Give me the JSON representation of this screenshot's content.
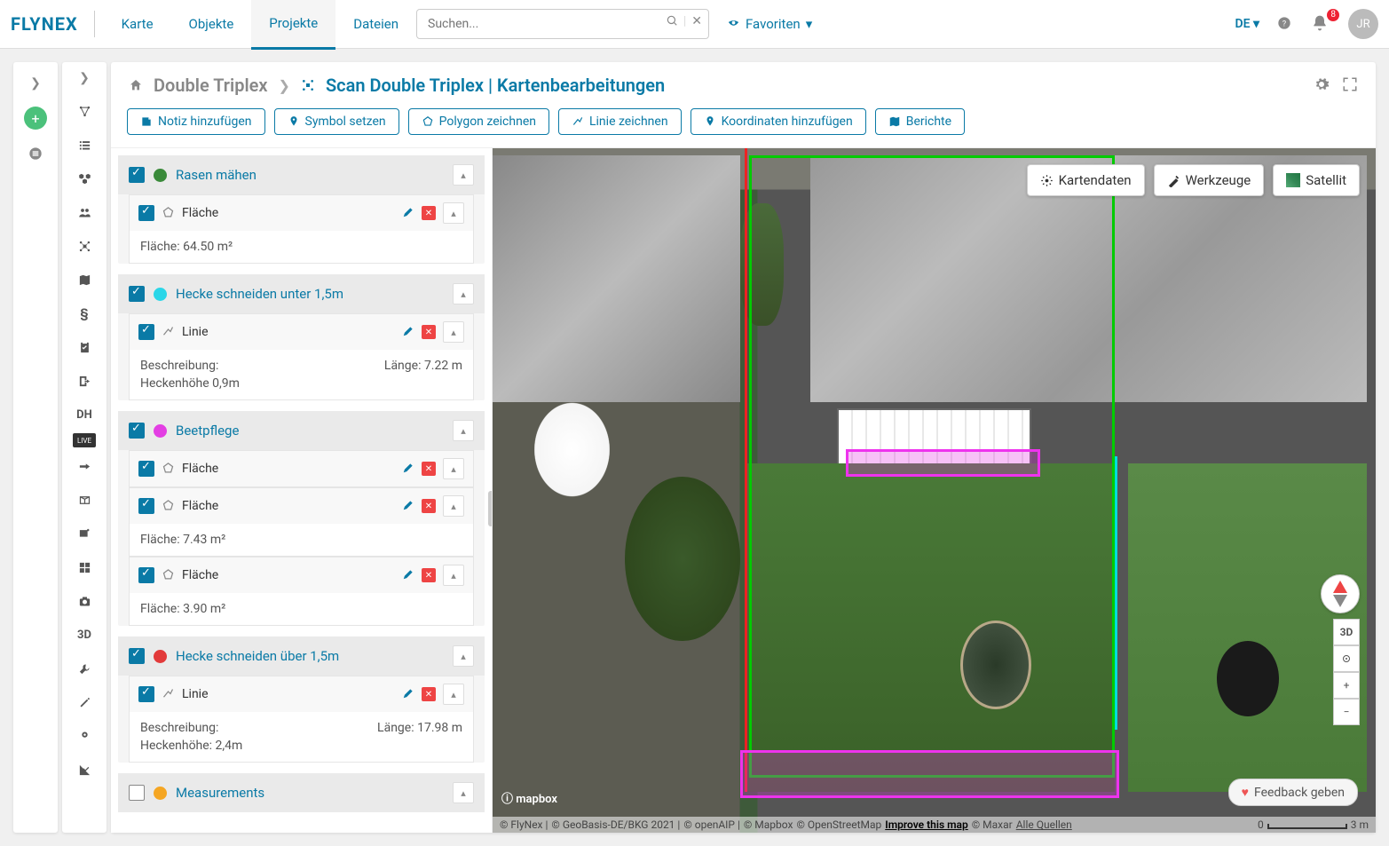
{
  "header": {
    "logo": "FLYNEX",
    "tabs": [
      "Karte",
      "Objekte",
      "Projekte",
      "Dateien"
    ],
    "active_tab": 2,
    "search_placeholder": "Suchen...",
    "favorites_label": "Favoriten",
    "lang": "DE",
    "notif_count": "8",
    "avatar": "JR"
  },
  "breadcrumb": {
    "object": "Double Triplex",
    "title": "Scan Double Triplex | Kartenbearbeitungen"
  },
  "toolbar": {
    "add_note": "Notiz hinzufügen",
    "set_symbol": "Symbol setzen",
    "draw_polygon": "Polygon zeichnen",
    "draw_line": "Linie zeichnen",
    "add_coords": "Koordinaten hinzufügen",
    "reports": "Berichte"
  },
  "map_btns": {
    "data": "Kartendaten",
    "tools": "Werkzeuge",
    "satellite": "Satellit",
    "three_d": "3D",
    "feedback": "Feedback geben",
    "scale_0": "0",
    "scale_3m": "3 m"
  },
  "attrib": {
    "a": "© FlyNex |",
    "b": "© GeoBasis-DE/BKG 2021 |",
    "c": "© openAIP |",
    "d": "© Mapbox",
    "e": "© OpenStreetMap",
    "f": "Improve this map",
    "g": "© Maxar",
    "h": "Alle Quellen"
  },
  "mapbox_logo": "ⓘ mapbox",
  "sidebar2_labels": {
    "dh": "DH",
    "live": "LIVE",
    "threeD": "3D"
  },
  "groups": [
    {
      "name": "Rasen mähen",
      "color": "#3a8a3a",
      "checked": true,
      "items": [
        {
          "shape": "poly",
          "label": "Fläche",
          "body_left": [
            "Fläche: 64.50 m²"
          ],
          "body_right": ""
        }
      ]
    },
    {
      "name": "Hecke schneiden unter 1,5m",
      "color": "#2ad6e8",
      "checked": true,
      "items": [
        {
          "shape": "line",
          "label": "Linie",
          "body_left": [
            "Beschreibung:",
            "Heckenhöhe 0,9m"
          ],
          "body_right": "Länge: 7.22 m"
        }
      ]
    },
    {
      "name": "Beetpflege",
      "color": "#e33ee3",
      "checked": true,
      "items": [
        {
          "shape": "poly",
          "label": "Fläche"
        },
        {
          "shape": "poly",
          "label": "Fläche",
          "body_left": [
            "Fläche: 7.43 m²"
          ],
          "body_right": ""
        },
        {
          "shape": "poly",
          "label": "Fläche",
          "body_left": [
            "Fläche: 3.90 m²"
          ],
          "body_right": ""
        }
      ]
    },
    {
      "name": "Hecke schneiden über 1,5m",
      "color": "#e23a3a",
      "checked": true,
      "items": [
        {
          "shape": "line",
          "label": "Linie",
          "body_left": [
            "Beschreibung:",
            "Heckenhöhe: 2,4m"
          ],
          "body_right": "Länge: 17.98 m"
        }
      ]
    },
    {
      "name": "Measurements",
      "color": "#f5a623",
      "checked": false,
      "items": []
    }
  ]
}
